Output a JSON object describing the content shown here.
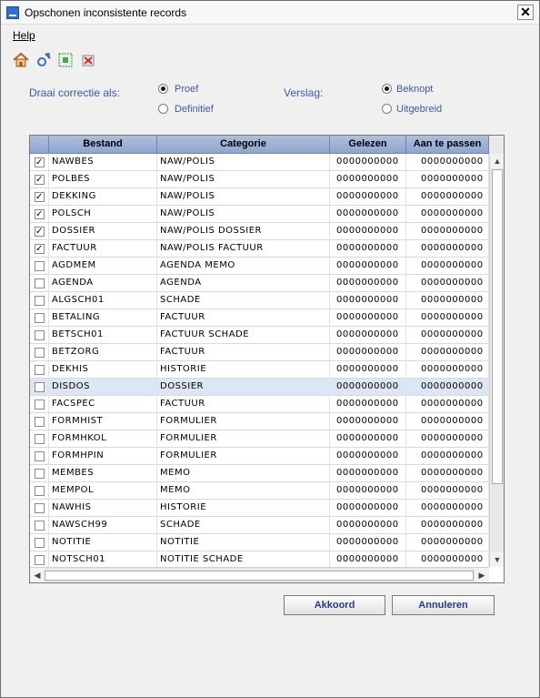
{
  "window": {
    "title": "Opschonen inconsistente records",
    "close_glyph": "✕"
  },
  "menu": {
    "help_label": "Help"
  },
  "toolbar": {
    "icons": [
      "home-icon",
      "settings-icon",
      "grid-select-icon",
      "delete-icon"
    ]
  },
  "options": {
    "run_label": "Draai correctie als:",
    "run_options": [
      {
        "label": "Proef",
        "checked": true
      },
      {
        "label": "Definitief",
        "checked": false
      }
    ],
    "report_label": "Verslag:",
    "report_options": [
      {
        "label": "Beknopt",
        "checked": true
      },
      {
        "label": "Uitgebreid",
        "checked": false
      }
    ]
  },
  "table": {
    "columns": [
      "Bestand",
      "Categorie",
      "Gelezen",
      "Aan te passen"
    ],
    "rows": [
      {
        "checked": true,
        "bestand": "NAWBES",
        "categorie": "NAW/POLIS",
        "gelezen": "0000000000",
        "aan": "0000000000"
      },
      {
        "checked": true,
        "bestand": "POLBES",
        "categorie": "NAW/POLIS",
        "gelezen": "0000000000",
        "aan": "0000000000"
      },
      {
        "checked": true,
        "bestand": "DEKKING",
        "categorie": "NAW/POLIS",
        "gelezen": "0000000000",
        "aan": "0000000000"
      },
      {
        "checked": true,
        "bestand": "POLSCH",
        "categorie": "NAW/POLIS",
        "gelezen": "0000000000",
        "aan": "0000000000"
      },
      {
        "checked": true,
        "bestand": "DOSSIER",
        "categorie": "NAW/POLIS DOSSIER",
        "gelezen": "0000000000",
        "aan": "0000000000"
      },
      {
        "checked": true,
        "bestand": "FACTUUR",
        "categorie": "NAW/POLIS FACTUUR",
        "gelezen": "0000000000",
        "aan": "0000000000"
      },
      {
        "checked": false,
        "bestand": "AGDMEM",
        "categorie": "AGENDA MEMO",
        "gelezen": "0000000000",
        "aan": "0000000000"
      },
      {
        "checked": false,
        "bestand": "AGENDA",
        "categorie": "AGENDA",
        "gelezen": "0000000000",
        "aan": "0000000000"
      },
      {
        "checked": false,
        "bestand": "ALGSCH01",
        "categorie": "SCHADE",
        "gelezen": "0000000000",
        "aan": "0000000000"
      },
      {
        "checked": false,
        "bestand": "BETALING",
        "categorie": "FACTUUR",
        "gelezen": "0000000000",
        "aan": "0000000000"
      },
      {
        "checked": false,
        "bestand": "BETSCH01",
        "categorie": "FACTUUR SCHADE",
        "gelezen": "0000000000",
        "aan": "0000000000"
      },
      {
        "checked": false,
        "bestand": "BETZORG",
        "categorie": "FACTUUR",
        "gelezen": "0000000000",
        "aan": "0000000000"
      },
      {
        "checked": false,
        "bestand": "DEKHIS",
        "categorie": "HISTORIE",
        "gelezen": "0000000000",
        "aan": "0000000000"
      },
      {
        "checked": false,
        "bestand": "DISDOS",
        "categorie": "DOSSIER",
        "gelezen": "0000000000",
        "aan": "0000000000",
        "selected": true
      },
      {
        "checked": false,
        "bestand": "FACSPEC",
        "categorie": "FACTUUR",
        "gelezen": "0000000000",
        "aan": "0000000000"
      },
      {
        "checked": false,
        "bestand": "FORMHIST",
        "categorie": "FORMULIER",
        "gelezen": "0000000000",
        "aan": "0000000000"
      },
      {
        "checked": false,
        "bestand": "FORMHKOL",
        "categorie": "FORMULIER",
        "gelezen": "0000000000",
        "aan": "0000000000"
      },
      {
        "checked": false,
        "bestand": "FORMHPIN",
        "categorie": "FORMULIER",
        "gelezen": "0000000000",
        "aan": "0000000000"
      },
      {
        "checked": false,
        "bestand": "MEMBES",
        "categorie": "MEMO",
        "gelezen": "0000000000",
        "aan": "0000000000"
      },
      {
        "checked": false,
        "bestand": "MEMPOL",
        "categorie": "MEMO",
        "gelezen": "0000000000",
        "aan": "0000000000"
      },
      {
        "checked": false,
        "bestand": "NAWHIS",
        "categorie": "HISTORIE",
        "gelezen": "0000000000",
        "aan": "0000000000"
      },
      {
        "checked": false,
        "bestand": "NAWSCH99",
        "categorie": "SCHADE",
        "gelezen": "0000000000",
        "aan": "0000000000"
      },
      {
        "checked": false,
        "bestand": "NOTITIE",
        "categorie": "NOTITIE",
        "gelezen": "0000000000",
        "aan": "0000000000"
      },
      {
        "checked": false,
        "bestand": "NOTSCH01",
        "categorie": "NOTITIE SCHADE",
        "gelezen": "0000000000",
        "aan": "0000000000"
      }
    ],
    "check_glyph": "✓",
    "scroll_up_glyph": "▲",
    "scroll_down_glyph": "▼",
    "scroll_left_glyph": "◀",
    "scroll_right_glyph": "▶"
  },
  "buttons": {
    "ok_label": "Akkoord",
    "cancel_label": "Annuleren"
  },
  "colors": {
    "label_blue": "#3a5ba8",
    "header_blue": "#8ea6cf",
    "selected_row": "#dce6f4"
  }
}
